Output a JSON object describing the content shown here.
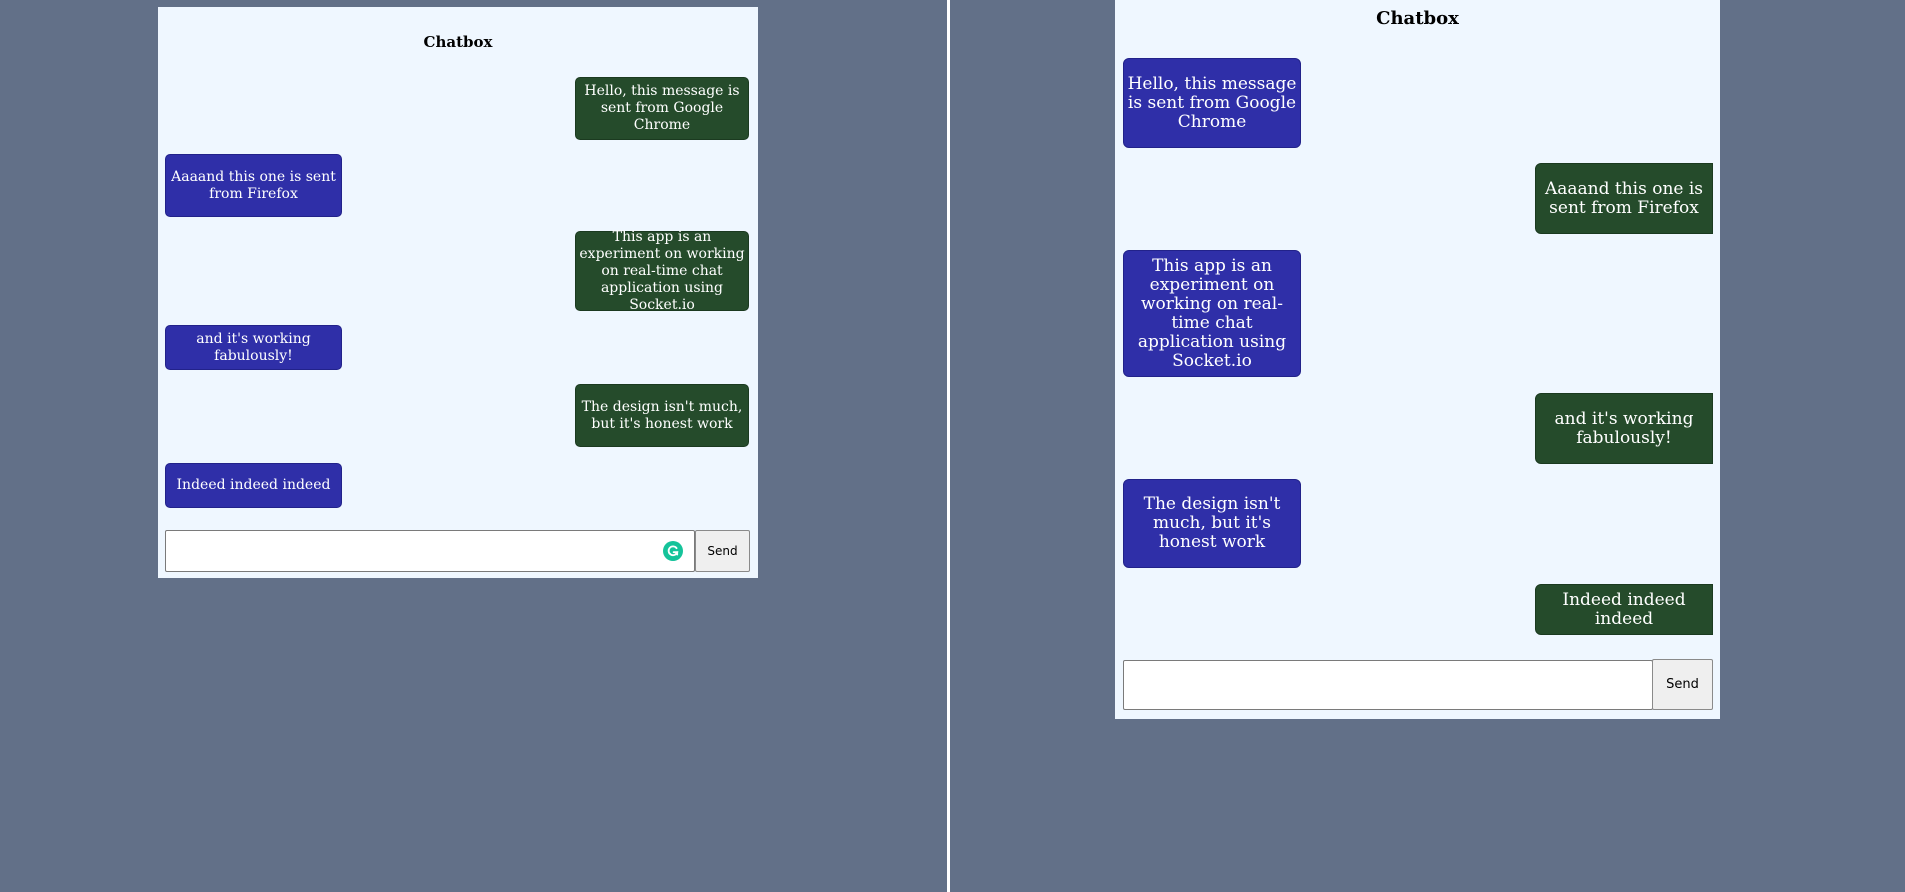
{
  "colors": {
    "page_background": "#627088",
    "chat_background": "#eff7ff",
    "bubble_blue": "#2f2fa8",
    "bubble_green": "#254b2b",
    "divider": "#ffffff",
    "grammarly": "#15c39a"
  },
  "left": {
    "title": "Chatbox",
    "messages": [
      {
        "side": "right",
        "color": "green",
        "text": "Hello, this message is sent from Google Chrome"
      },
      {
        "side": "left",
        "color": "blue",
        "text": "Aaaand this one is sent from Firefox"
      },
      {
        "side": "right",
        "color": "green",
        "text": "This app is an experiment on working on real-time chat application using Socket.io"
      },
      {
        "side": "left",
        "color": "blue",
        "text": "and it's working fabulously!"
      },
      {
        "side": "right",
        "color": "green",
        "text": "The design isn't much, but it's honest work"
      },
      {
        "side": "left",
        "color": "blue",
        "text": "Indeed indeed indeed"
      }
    ],
    "input": {
      "value": "",
      "placeholder": ""
    },
    "extension_icon": "grammarly-icon",
    "send_label": "Send"
  },
  "right": {
    "title": "Chatbox",
    "messages": [
      {
        "side": "left",
        "color": "blue",
        "text": "Hello, this message is sent from Google Chrome"
      },
      {
        "side": "right",
        "color": "green",
        "text": "Aaaand this one is sent from Firefox"
      },
      {
        "side": "left",
        "color": "blue",
        "text": "This app is an experiment on working on real-time chat application using Socket.io"
      },
      {
        "side": "right",
        "color": "green",
        "text": "and it's working fabulously!"
      },
      {
        "side": "left",
        "color": "blue",
        "text": "The design isn't much, but it's honest work"
      },
      {
        "side": "right",
        "color": "green",
        "text": "Indeed indeed indeed"
      }
    ],
    "input": {
      "value": "",
      "placeholder": ""
    },
    "send_label": "Send"
  }
}
